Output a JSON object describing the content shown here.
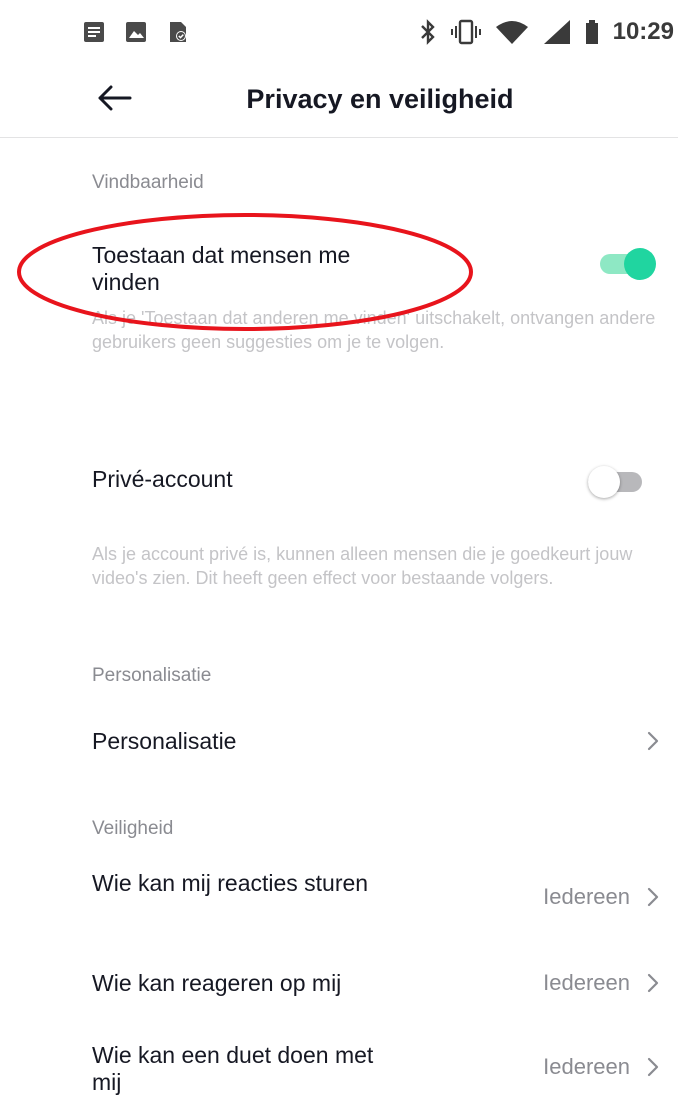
{
  "status_bar": {
    "time": "10:29",
    "left_icons": [
      "message-icon",
      "image-icon",
      "file-check-icon"
    ],
    "right_icons": [
      "bluetooth-icon",
      "vibrate-icon",
      "wifi-icon",
      "signal-icon",
      "battery-icon"
    ]
  },
  "header": {
    "title": "Privacy en veiligheid",
    "back_icon": "arrow-left-icon"
  },
  "sections": {
    "vindbaarheid": {
      "label": "Vindbaarheid",
      "allow_find": {
        "title": "Toestaan dat mensen me vinden",
        "enabled": true,
        "description": "Als je 'Toestaan dat anderen me vinden' uitschakelt, ontvangen andere gebruikers geen suggesties om je te volgen."
      },
      "private_account": {
        "title": "Privé-account",
        "enabled": false,
        "description": "Als je account privé is, kunnen alleen mensen die je goedkeurt jouw video's zien. Dit heeft geen effect voor bestaande volgers."
      }
    },
    "personalisatie": {
      "label": "Personalisatie",
      "item": {
        "title": "Personalisatie"
      }
    },
    "veiligheid": {
      "label": "Veiligheid",
      "items": [
        {
          "title": "Wie kan mij reacties sturen",
          "value": "Iedereen"
        },
        {
          "title": "Wie kan reageren op mij",
          "value": "Iedereen"
        },
        {
          "title": "Wie kan een duet doen met mij",
          "value": "Iedereen"
        }
      ]
    }
  },
  "colors": {
    "toggle_on": "#20d5a0",
    "toggle_on_track": "#8ee8c4",
    "toggle_off_track": "#b8b8bb",
    "annotation": "#e8141c",
    "text_primary": "#161823",
    "text_secondary": "#8a8b91",
    "text_description": "#c4c4c7"
  }
}
